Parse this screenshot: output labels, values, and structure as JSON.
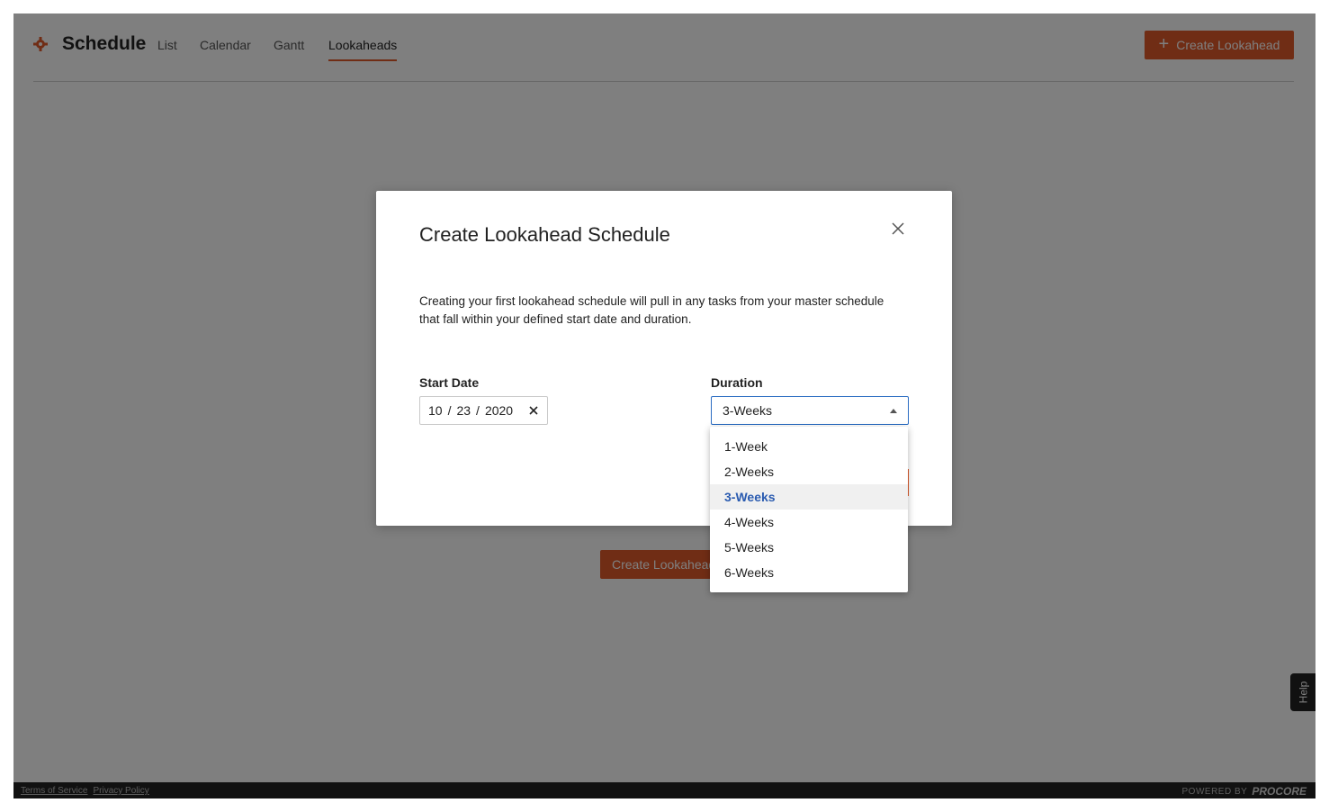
{
  "header": {
    "app_title": "Schedule",
    "tabs": [
      {
        "label": "List"
      },
      {
        "label": "Calendar"
      },
      {
        "label": "Gantt"
      },
      {
        "label": "Lookaheads",
        "active": true
      }
    ],
    "create_button_label": "Create Lookahead",
    "create_button_icon": "plus-icon"
  },
  "page": {
    "create_button_label": "Create Lookahead"
  },
  "help_label": "Help",
  "footer": {
    "terms": "Terms of Service",
    "privacy": "Privacy Policy",
    "powered_by": "POWERED BY",
    "brand": "PROCORE"
  },
  "modal": {
    "title": "Create Lookahead Schedule",
    "description": "Creating your first lookahead schedule will pull in any tasks from your master schedule that fall within your defined start date and duration.",
    "start_date": {
      "label": "Start Date",
      "month": "10",
      "day": "23",
      "year": "2020",
      "separator": "/"
    },
    "duration": {
      "label": "Duration",
      "selected": "3-Weeks",
      "options": [
        "1-Week",
        "2-Weeks",
        "3-Weeks",
        "4-Weeks",
        "5-Weeks",
        "6-Weeks"
      ]
    }
  },
  "colors": {
    "accent": "#e05a2b",
    "focus_border": "#2a6cc2",
    "selected_option_text": "#2a5bb0",
    "footer_bg": "#222222"
  }
}
